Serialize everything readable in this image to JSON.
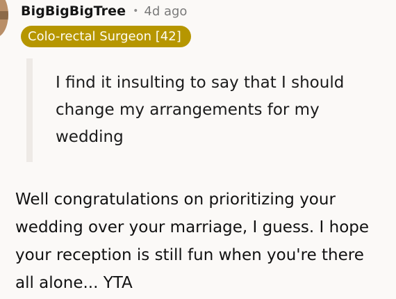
{
  "comment": {
    "author": "BigBigBigTree",
    "separator": "•",
    "time_ago": "4d ago",
    "flair": "Colo-rectal Surgeon [42]",
    "quote_lines": [
      "I find it insulting to say that I should",
      "change my arrangements for my",
      "wedding"
    ],
    "body_lines": [
      "Well congratulations on prioritizing your",
      "wedding over your marriage, I guess. I hope",
      "your reception is still fun when you're there",
      "all alone... YTA"
    ]
  },
  "colors": {
    "flair_bg": "#b69600",
    "flair_text": "#fffdf3",
    "background": "#fbf9f7",
    "quote_bar": "#eeeae6",
    "avatar": "#b98f68"
  }
}
